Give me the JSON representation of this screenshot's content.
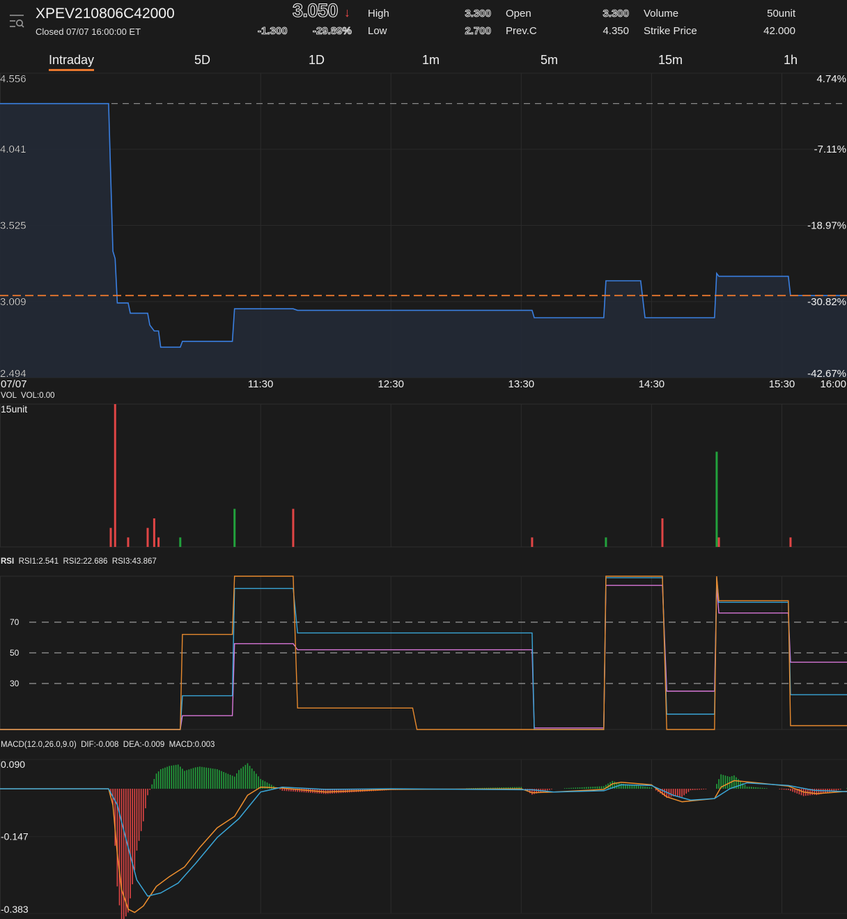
{
  "header": {
    "symbol": "XPEV210806C42000",
    "status": "Closed  07/07 16:00:00 ET",
    "last_price": "3.050",
    "direction_icon": "arrow-down-icon",
    "change": "-1.300",
    "change_pct": "-29.89%",
    "stats": {
      "high_label": "High",
      "high": "3.300",
      "low_label": "Low",
      "low": "2.700",
      "open_label": "Open",
      "open": "3.300",
      "prevc_label": "Prev.C",
      "prevc": "4.350",
      "volume_label": "Volume",
      "volume": "50unit",
      "strike_label": "Strike Price",
      "strike": "42.000"
    }
  },
  "tabs": [
    {
      "label": "Intraday",
      "active": true
    },
    {
      "label": "5D",
      "active": false
    },
    {
      "label": "1D",
      "active": false
    },
    {
      "label": "1m",
      "active": false
    },
    {
      "label": "5m",
      "active": false
    },
    {
      "label": "15m",
      "active": false
    },
    {
      "label": "1h",
      "active": false
    }
  ],
  "colors": {
    "price_line": "#3a7fe0",
    "prev_close_line": "#e8772e",
    "up": "#22a13c",
    "down": "#e04545",
    "rsi1": "#e88a2e",
    "rsi2": "#3aa6d8",
    "rsi3": "#d877d8",
    "dif": "#f0902e",
    "dea": "#3aa6d8"
  },
  "chart_data": [
    {
      "type": "line",
      "title": "Intraday price",
      "xlabel": "",
      "ylabel": "",
      "x_ticks": [
        "07/07",
        "11:30",
        "12:30",
        "13:30",
        "14:30",
        "15:30",
        "16:00"
      ],
      "x_range": [
        "09:30",
        "16:00"
      ],
      "y_ticks_left": [
        "4.556",
        "4.041",
        "3.525",
        "3.009",
        "2.494"
      ],
      "y_ticks_right": [
        "4.74%",
        "-7.11%",
        "-18.97%",
        "-30.82%",
        "-42.67%"
      ],
      "ylim": [
        2.494,
        4.556
      ],
      "reference_lines": [
        {
          "name": "prev_close",
          "value": 4.35,
          "style": "dashed-gray"
        },
        {
          "name": "last_price",
          "value": 3.05,
          "style": "dashed-orange"
        }
      ],
      "series": [
        {
          "name": "price",
          "points": [
            [
              "09:30",
              4.35
            ],
            [
              "10:20",
              4.35
            ],
            [
              "10:22",
              3.35
            ],
            [
              "10:23",
              3.3
            ],
            [
              "10:24",
              3.0
            ],
            [
              "10:29",
              3.0
            ],
            [
              "10:30",
              2.93
            ],
            [
              "10:38",
              2.93
            ],
            [
              "10:39",
              2.85
            ],
            [
              "10:41",
              2.81
            ],
            [
              "10:43",
              2.81
            ],
            [
              "10:44",
              2.7
            ],
            [
              "10:53",
              2.7
            ],
            [
              "10:54",
              2.74
            ],
            [
              "11:17",
              2.74
            ],
            [
              "11:18",
              2.96
            ],
            [
              "11:45",
              2.96
            ],
            [
              "11:47",
              2.95
            ],
            [
              "13:35",
              2.95
            ],
            [
              "13:36",
              2.9
            ],
            [
              "14:08",
              2.9
            ],
            [
              "14:09",
              3.15
            ],
            [
              "14:25",
              3.15
            ],
            [
              "14:27",
              2.9
            ],
            [
              "14:59",
              2.9
            ],
            [
              "15:00",
              3.2
            ],
            [
              "15:01",
              3.18
            ],
            [
              "15:33",
              3.18
            ],
            [
              "15:34",
              3.05
            ],
            [
              "16:00",
              3.05
            ]
          ]
        }
      ]
    },
    {
      "type": "bar",
      "title": "VOL",
      "header_text": "VOL  VOL:0.00",
      "y_max_label": "15unit",
      "ylim": [
        0,
        15
      ],
      "bars": [
        {
          "t": "10:21",
          "v": 2,
          "dir": "down"
        },
        {
          "t": "10:23",
          "v": 15,
          "dir": "down"
        },
        {
          "t": "10:29",
          "v": 1,
          "dir": "down"
        },
        {
          "t": "10:38",
          "v": 2,
          "dir": "down"
        },
        {
          "t": "10:41",
          "v": 3,
          "dir": "down"
        },
        {
          "t": "10:43",
          "v": 1,
          "dir": "down"
        },
        {
          "t": "10:53",
          "v": 1,
          "dir": "up"
        },
        {
          "t": "11:18",
          "v": 4,
          "dir": "up"
        },
        {
          "t": "11:45",
          "v": 4,
          "dir": "down"
        },
        {
          "t": "13:35",
          "v": 1,
          "dir": "down"
        },
        {
          "t": "14:09",
          "v": 1,
          "dir": "up"
        },
        {
          "t": "14:35",
          "v": 3,
          "dir": "down"
        },
        {
          "t": "15:00",
          "v": 10,
          "dir": "up"
        },
        {
          "t": "15:01",
          "v": 1,
          "dir": "down"
        },
        {
          "t": "15:34",
          "v": 1,
          "dir": "down"
        }
      ]
    },
    {
      "type": "line",
      "title": "RSI",
      "legend": [
        "RSI1:2.541",
        "RSI2:22.686",
        "RSI3:43.867"
      ],
      "y_ticks": [
        "70",
        "50",
        "30"
      ],
      "ylim": [
        0,
        100
      ],
      "series": [
        {
          "name": "RSI1",
          "points": [
            [
              "09:30",
              0
            ],
            [
              "10:53",
              0
            ],
            [
              "10:54",
              62
            ],
            [
              "11:17",
              62
            ],
            [
              "11:18",
              100
            ],
            [
              "11:45",
              100
            ],
            [
              "11:47",
              14
            ],
            [
              "12:40",
              14
            ],
            [
              "12:42",
              0
            ],
            [
              "13:35",
              0
            ],
            [
              "13:36",
              0
            ],
            [
              "14:08",
              0
            ],
            [
              "14:09",
              100
            ],
            [
              "14:35",
              100
            ],
            [
              "14:37",
              0
            ],
            [
              "14:59",
              0
            ],
            [
              "15:00",
              100
            ],
            [
              "15:01",
              84
            ],
            [
              "15:33",
              84
            ],
            [
              "15:34",
              2.5
            ],
            [
              "16:00",
              2.5
            ]
          ]
        },
        {
          "name": "RSI2",
          "points": [
            [
              "09:30",
              0
            ],
            [
              "10:53",
              0
            ],
            [
              "10:54",
              22
            ],
            [
              "11:17",
              22
            ],
            [
              "11:18",
              92
            ],
            [
              "11:45",
              92
            ],
            [
              "11:47",
              63
            ],
            [
              "13:35",
              63
            ],
            [
              "13:36",
              0
            ],
            [
              "14:08",
              0
            ],
            [
              "14:09",
              99
            ],
            [
              "14:35",
              99
            ],
            [
              "14:37",
              10
            ],
            [
              "14:59",
              10
            ],
            [
              "15:00",
              99
            ],
            [
              "15:01",
              83
            ],
            [
              "15:33",
              83
            ],
            [
              "15:34",
              22.7
            ],
            [
              "16:00",
              22.7
            ]
          ]
        },
        {
          "name": "RSI3",
          "points": [
            [
              "09:30",
              0
            ],
            [
              "10:53",
              0
            ],
            [
              "10:54",
              9
            ],
            [
              "11:17",
              9
            ],
            [
              "11:18",
              56
            ],
            [
              "11:45",
              56
            ],
            [
              "11:47",
              52
            ],
            [
              "13:35",
              52
            ],
            [
              "13:36",
              1
            ],
            [
              "14:08",
              1
            ],
            [
              "14:09",
              94
            ],
            [
              "14:35",
              94
            ],
            [
              "14:37",
              25
            ],
            [
              "14:59",
              25
            ],
            [
              "15:00",
              94
            ],
            [
              "15:01",
              76
            ],
            [
              "15:33",
              76
            ],
            [
              "15:34",
              43.9
            ],
            [
              "16:00",
              43.9
            ]
          ]
        }
      ]
    },
    {
      "type": "line",
      "title": "MACD",
      "legend": [
        "MACD(12.0,26.0,9.0)",
        "DIF:-0.008",
        "DEA:-0.009",
        "MACD:0.003"
      ],
      "y_ticks": [
        "0.090",
        "-0.147",
        "-0.383"
      ],
      "ylim": [
        -0.383,
        0.09
      ],
      "series": [
        {
          "name": "DIF",
          "points": [
            [
              "09:30",
              0
            ],
            [
              "10:20",
              0
            ],
            [
              "10:22",
              -0.05
            ],
            [
              "10:24",
              -0.2
            ],
            [
              "10:26",
              -0.31
            ],
            [
              "10:29",
              -0.37
            ],
            [
              "10:32",
              -0.38
            ],
            [
              "10:36",
              -0.36
            ],
            [
              "10:42",
              -0.3
            ],
            [
              "10:48",
              -0.27
            ],
            [
              "10:55",
              -0.24
            ],
            [
              "11:02",
              -0.18
            ],
            [
              "11:10",
              -0.12
            ],
            [
              "11:18",
              -0.085
            ],
            [
              "11:24",
              -0.02
            ],
            [
              "11:30",
              0.005
            ],
            [
              "11:40",
              0.002
            ],
            [
              "12:00",
              -0.01
            ],
            [
              "12:30",
              -0.002
            ],
            [
              "13:30",
              0
            ],
            [
              "13:35",
              -0.012
            ],
            [
              "13:45",
              -0.01
            ],
            [
              "14:08",
              -0.002
            ],
            [
              "14:12",
              0.015
            ],
            [
              "14:16",
              0.02
            ],
            [
              "14:30",
              0.012
            ],
            [
              "14:37",
              -0.025
            ],
            [
              "14:44",
              -0.04
            ],
            [
              "14:59",
              -0.03
            ],
            [
              "15:02",
              0.005
            ],
            [
              "15:08",
              0.025
            ],
            [
              "15:16",
              0.02
            ],
            [
              "15:33",
              0.008
            ],
            [
              "15:40",
              -0.01
            ],
            [
              "15:46",
              -0.015
            ],
            [
              "16:00",
              -0.008
            ]
          ]
        },
        {
          "name": "DEA",
          "points": [
            [
              "09:30",
              0
            ],
            [
              "10:20",
              0
            ],
            [
              "10:24",
              -0.05
            ],
            [
              "10:29",
              -0.18
            ],
            [
              "10:33",
              -0.28
            ],
            [
              "10:38",
              -0.33
            ],
            [
              "10:44",
              -0.32
            ],
            [
              "10:52",
              -0.29
            ],
            [
              "11:00",
              -0.23
            ],
            [
              "11:10",
              -0.15
            ],
            [
              "11:20",
              -0.092
            ],
            [
              "11:30",
              -0.01
            ],
            [
              "11:40",
              0.005
            ],
            [
              "12:00",
              -0.002
            ],
            [
              "12:30",
              0
            ],
            [
              "13:35",
              -0.003
            ],
            [
              "13:45",
              -0.01
            ],
            [
              "14:08",
              -0.006
            ],
            [
              "14:16",
              0.012
            ],
            [
              "14:30",
              0.01
            ],
            [
              "14:40",
              -0.02
            ],
            [
              "14:48",
              -0.035
            ],
            [
              "14:59",
              -0.03
            ],
            [
              "15:06",
              0.0
            ],
            [
              "15:14",
              0.018
            ],
            [
              "15:33",
              0.01
            ],
            [
              "15:45",
              -0.005
            ],
            [
              "16:00",
              -0.009
            ]
          ]
        }
      ],
      "histogram_note": "MACD histogram bars = 2*(DIF-DEA); green above zero, red below"
    }
  ]
}
